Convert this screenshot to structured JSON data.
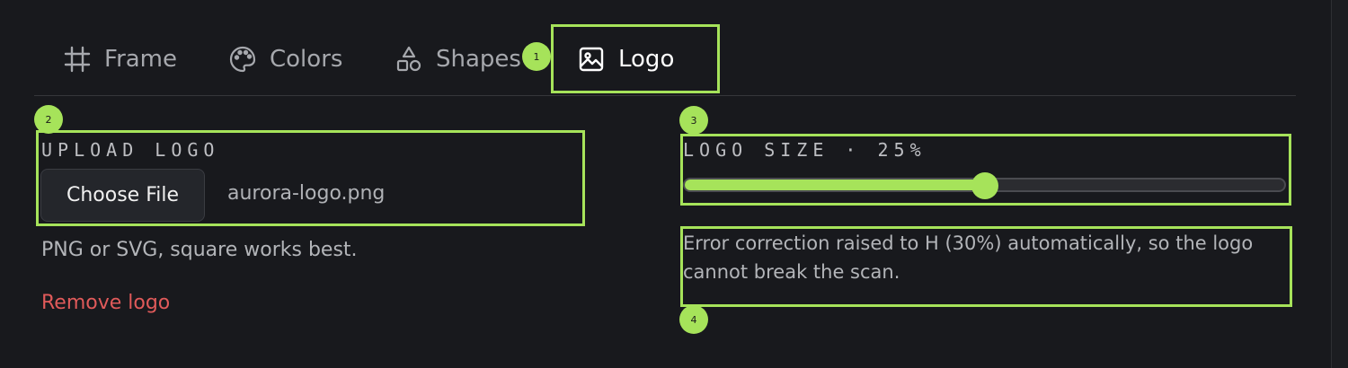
{
  "tabs": [
    {
      "label": "Frame",
      "icon": "frame-icon"
    },
    {
      "label": "Colors",
      "icon": "palette-icon"
    },
    {
      "label": "Shapes",
      "icon": "shapes-icon"
    },
    {
      "label": "Logo",
      "icon": "image-icon",
      "active": true
    }
  ],
  "markers": [
    "1",
    "2",
    "3",
    "4"
  ],
  "upload": {
    "section_label": "UPLOAD LOGO",
    "button_label": "Choose File",
    "filename": "aurora-logo.png",
    "hint": "PNG or SVG, square works best.",
    "remove_label": "Remove logo"
  },
  "logo_size": {
    "label": "LOGO SIZE · 25%",
    "value_percent": 25,
    "slider_fill_fraction": 0.5
  },
  "note": "Error correction raised to H (30%) automatically, so the logo cannot break the scan.",
  "colors": {
    "accent": "#a6e35a",
    "background": "#18191d",
    "danger": "#e05a5a"
  }
}
